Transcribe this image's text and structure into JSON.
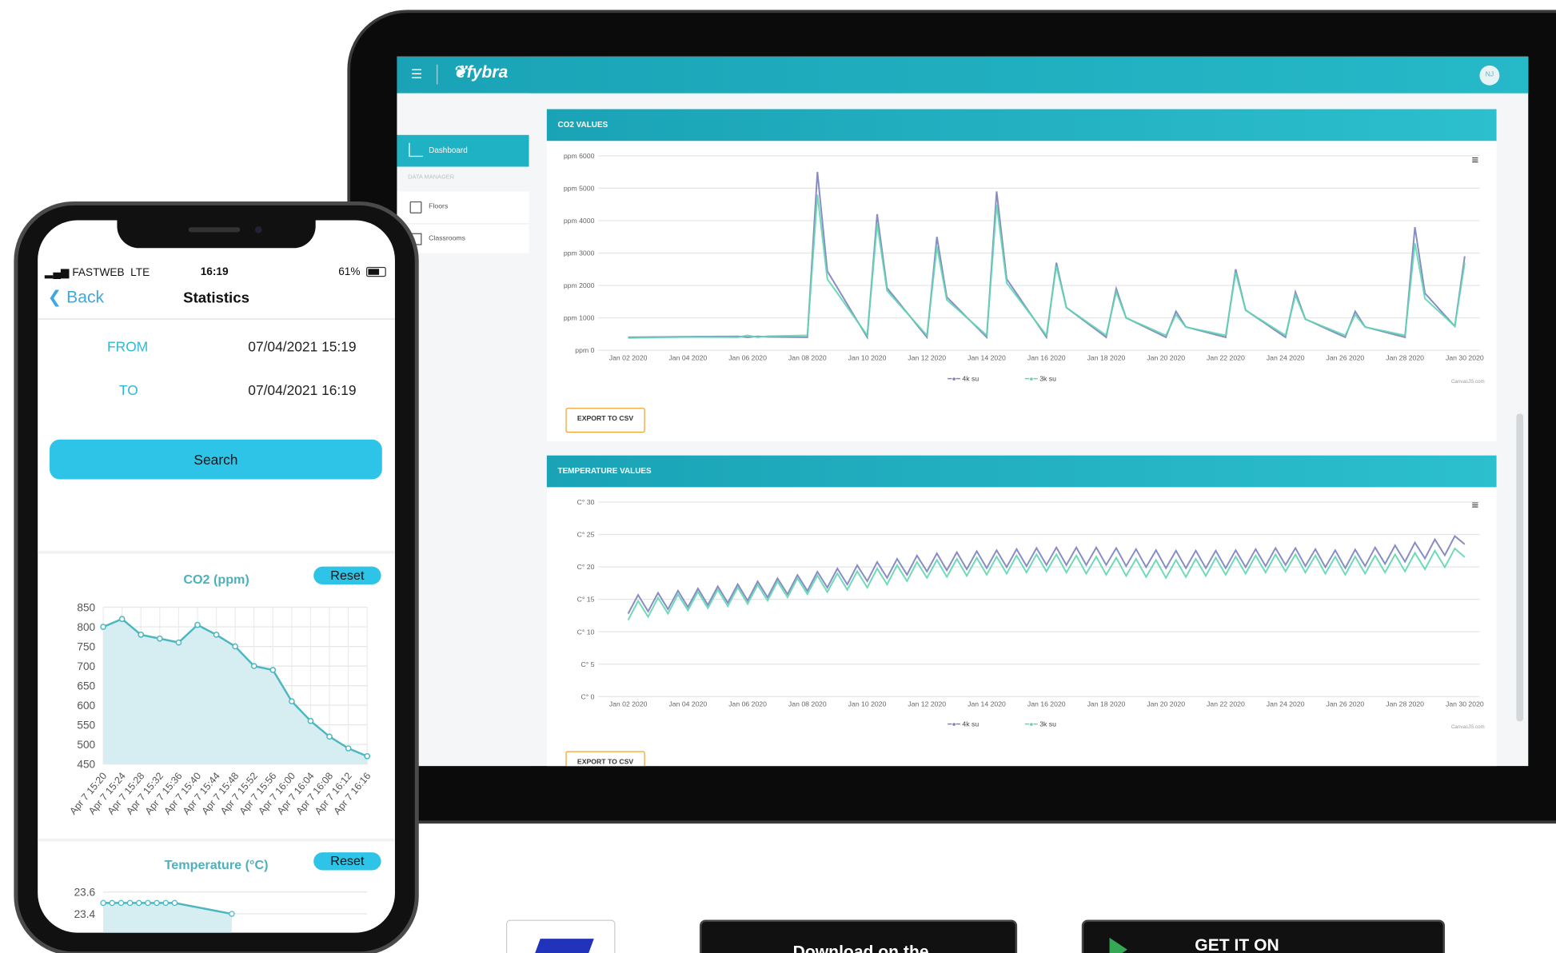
{
  "tablet": {
    "brand": "fybra",
    "avatar_initials": "NJ",
    "sidebar": {
      "items": [
        {
          "label": "Dashboard",
          "icon": "chart-icon"
        },
        {
          "label": "Floors",
          "icon": "floor-icon"
        },
        {
          "label": "Classrooms",
          "icon": "classroom-icon"
        }
      ],
      "section": "DATA MANAGER"
    },
    "co2_panel": {
      "title": "CO2 VALUES",
      "export_label": "EXPORT TO CSV",
      "credit": "CanvasJS.com"
    },
    "temp_panel": {
      "title": "TEMPERATURE VALUES",
      "export_label": "EXPORT TO CSV",
      "credit": "CanvasJS.com"
    }
  },
  "phone": {
    "carrier": "FASTWEB",
    "network": "LTE",
    "time": "16:19",
    "battery": "61%",
    "battery_level": 0.61,
    "back_label": "Back",
    "title": "Statistics",
    "from_label": "FROM",
    "from_value": "07/04/2021 15:19",
    "to_label": "TO",
    "to_value": "07/04/2021 16:19",
    "search_label": "Search",
    "co2_title": "CO2 (ppm)",
    "temp_title": "Temperature (°C)",
    "reset_label": "Reset"
  },
  "colors": {
    "accent": "#1fb2c4",
    "series_4k": "#7b7fbf",
    "series_3k": "#5fd6b0",
    "phone_accent": "#2ec4e8",
    "export_border": "#f0a230"
  },
  "chart_data": [
    {
      "type": "line",
      "title": "CO2 VALUES",
      "categories": [
        "Jan 02 2020",
        "Jan 04 2020",
        "Jan 06 2020",
        "Jan 08 2020",
        "Jan 10 2020",
        "Jan 12 2020",
        "Jan 14 2020",
        "Jan 16 2020",
        "Jan 18 2020",
        "Jan 20 2020",
        "Jan 22 2020",
        "Jan 24 2020",
        "Jan 26 2020",
        "Jan 28 2020",
        "Jan 30 2020"
      ],
      "y_ticks": [
        "ppm 0",
        "ppm 1000",
        "ppm 2000",
        "ppm 3000",
        "ppm 4000",
        "ppm 5000",
        "ppm 6000"
      ],
      "ylim": [
        0,
        6000
      ],
      "series": [
        {
          "name": "4k su",
          "values": [
            400,
            420,
            430,
            5500,
            4200,
            3500,
            4900,
            2700,
            1900,
            1200,
            2500,
            1800,
            1200,
            3800,
            2900
          ]
        },
        {
          "name": "3k su",
          "values": [
            380,
            410,
            400,
            4800,
            3900,
            3200,
            4500,
            2600,
            1800,
            1100,
            2400,
            1700,
            1100,
            3300,
            2700
          ]
        }
      ],
      "legend": "bottom-center",
      "grid": true
    },
    {
      "type": "line",
      "title": "TEMPERATURE VALUES",
      "categories": [
        "Jan 02 2020",
        "Jan 04 2020",
        "Jan 06 2020",
        "Jan 08 2020",
        "Jan 10 2020",
        "Jan 12 2020",
        "Jan 14 2020",
        "Jan 16 2020",
        "Jan 18 2020",
        "Jan 20 2020",
        "Jan 22 2020",
        "Jan 24 2020",
        "Jan 26 2020",
        "Jan 28 2020",
        "Jan 30 2020"
      ],
      "y_ticks": [
        "C° 0",
        "C° 5",
        "C° 10",
        "C° 15",
        "C° 20",
        "C° 25",
        "C° 30"
      ],
      "ylim": [
        0,
        30
      ],
      "series": [
        {
          "name": "4k su",
          "values": [
            14,
            15,
            16,
            17.5,
            19,
            20.5,
            21,
            21.5,
            21.5,
            21,
            21,
            21.5,
            21,
            22,
            23.5
          ]
        },
        {
          "name": "3k su",
          "values": [
            13,
            14.5,
            15.5,
            17,
            18,
            19.5,
            20,
            20.5,
            20,
            19.5,
            20,
            20.5,
            20,
            20.5,
            21.5
          ]
        }
      ],
      "legend": "bottom-center",
      "grid": true
    },
    {
      "type": "area",
      "title": "CO2 (ppm)",
      "x": [
        "Apr 7 15:20",
        "Apr 7 15:24",
        "Apr 7 15:28",
        "Apr 7 15:32",
        "Apr 7 15:36",
        "Apr 7 15:40",
        "Apr 7 15:44",
        "Apr 7 15:48",
        "Apr 7 15:52",
        "Apr 7 15:56",
        "Apr 7 16:00",
        "Apr 7 16:04",
        "Apr 7 16:08",
        "Apr 7 16:12",
        "Apr 7 16:16"
      ],
      "y_ticks": [
        "850",
        "800",
        "750",
        "700",
        "650",
        "600",
        "550",
        "500",
        "450"
      ],
      "ylim": [
        450,
        850
      ],
      "values": [
        800,
        820,
        780,
        770,
        760,
        805,
        780,
        750,
        700,
        690,
        610,
        560,
        520,
        490,
        470
      ]
    },
    {
      "type": "area",
      "title": "Temperature (°C)",
      "y_ticks": [
        "23.6",
        "23.4"
      ],
      "values": [
        23.5,
        23.5,
        23.5,
        23.5,
        23.5,
        23.5,
        23.5,
        23.5,
        23.5,
        23.4
      ]
    }
  ],
  "badges": [
    {
      "label": "Download on the"
    },
    {
      "label": "GET IT ON"
    }
  ]
}
